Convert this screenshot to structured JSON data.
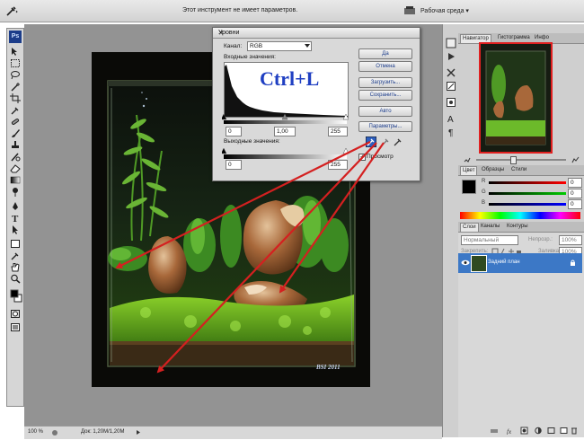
{
  "options_bar": {
    "hint": "Этот инструмент не имеет параметров.",
    "workspace_label": "Рабочая среда ▾"
  },
  "toolbox": {
    "logo": "Ps",
    "tools": [
      "move-icon",
      "marquee-icon",
      "lasso-icon",
      "magic-wand-icon",
      "crop-icon",
      "eyedropper-icon",
      "healing-icon",
      "brush-icon",
      "stamp-icon",
      "history-brush-icon",
      "eraser-icon",
      "gradient-icon",
      "dodge-icon",
      "pen-icon",
      "type-icon",
      "path-select-icon",
      "shape-icon",
      "notes-icon",
      "eyedropper-icon",
      "hand-icon",
      "zoom-icon"
    ]
  },
  "levels_dialog": {
    "title": "Уровни",
    "channel_label": "Канал:",
    "channel_value": "RGB",
    "input_label": "Входные значения:",
    "input_black": "0",
    "input_gamma": "1,00",
    "input_white": "255",
    "output_label": "Выходные значения:",
    "output_black": "0",
    "output_white": "255",
    "buttons": {
      "ok": "Да",
      "cancel": "Отмена",
      "load": "Загрузить...",
      "save": "Сохранить...",
      "auto": "Авто",
      "options": "Параметры..."
    },
    "preview_label": "Просмотр",
    "preview_checked": true
  },
  "overlay_text": "Ctrl+L",
  "photo": {
    "watermark": "BSI 2011"
  },
  "status_bar": {
    "zoom": "100 %",
    "doc_size": "Док: 1,20M/1,20M"
  },
  "navigator_panel": {
    "tabs": [
      "Навигатор",
      "Гистограмма",
      "Инфо"
    ],
    "active_tab": 0
  },
  "color_panel": {
    "tabs": [
      "Цвет",
      "Образцы",
      "Стили"
    ],
    "active_tab": 0,
    "r_label": "R",
    "g_label": "G",
    "b_label": "B",
    "r_value": "0",
    "g_value": "0",
    "b_value": "0"
  },
  "layers_panel": {
    "tabs": [
      "Слои",
      "Каналы",
      "Контуры"
    ],
    "active_tab": 0,
    "blend_mode": "Нормальный",
    "opacity_label": "Непрозр.:",
    "opacity_value": "100%",
    "lock_label": "Закрепить:",
    "fill_label": "Заливка:",
    "fill_value": "100%",
    "layer_name": "Задний план"
  },
  "colors": {
    "arrow_red": "#d42020",
    "layer_highlight": "#3c78c6",
    "ps_blue": "#1c3d8a",
    "overlay_text_blue": "#1f3fc2"
  }
}
